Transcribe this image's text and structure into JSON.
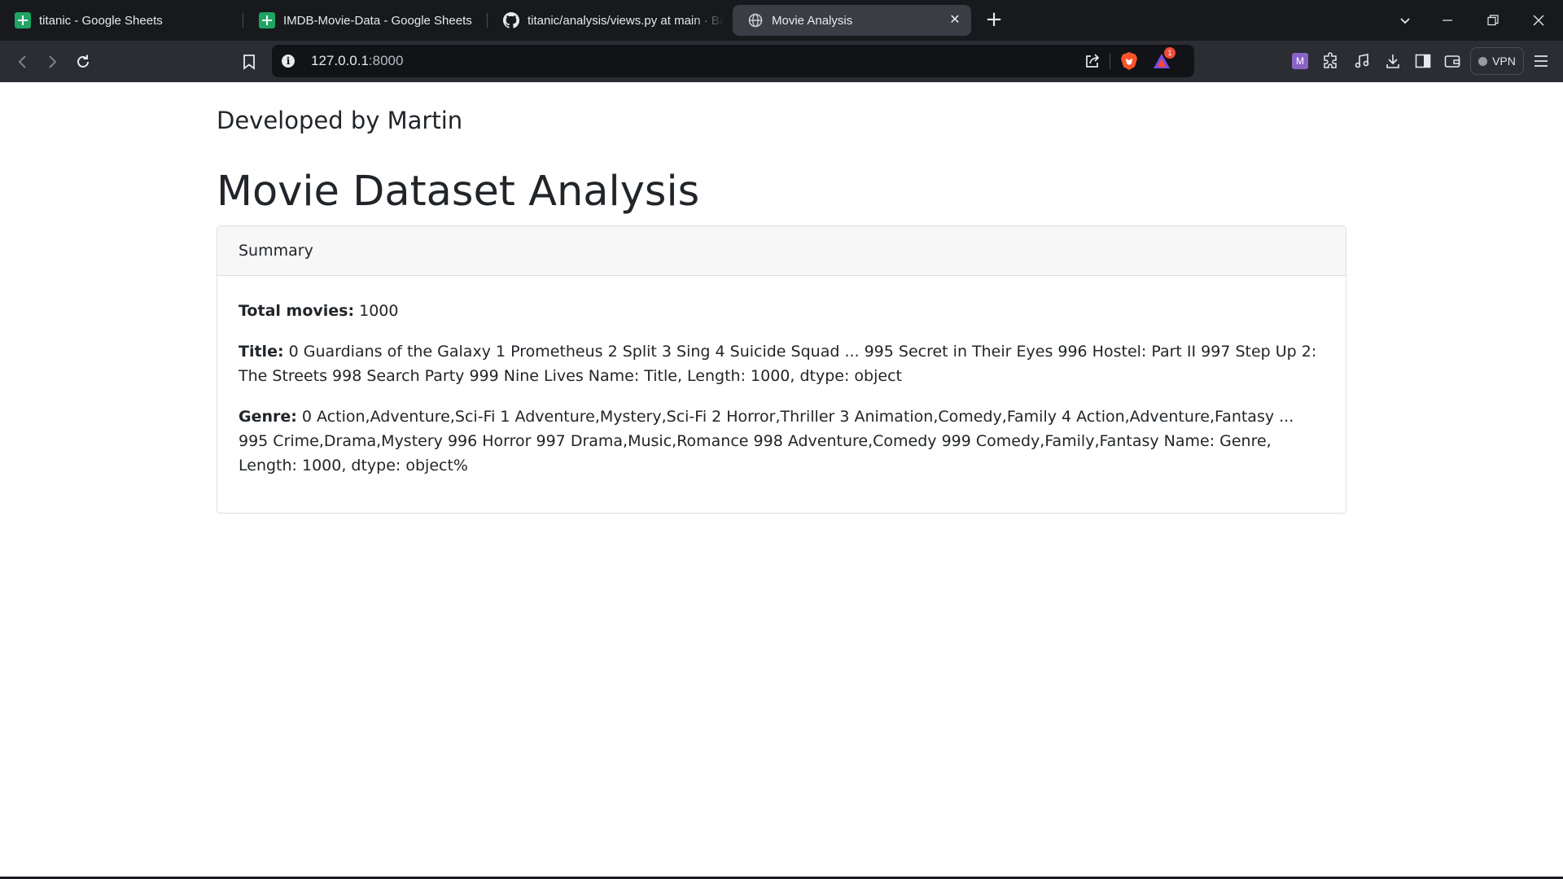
{
  "tabs": [
    {
      "title": "titanic - Google Sheets",
      "icon": "google-sheets-icon"
    },
    {
      "title": "IMDB-Movie-Data - Google Sheets",
      "icon": "google-sheets-icon"
    },
    {
      "title": "titanic/analysis/views.py at main · Ba",
      "icon": "github-icon"
    },
    {
      "title": "Movie Analysis",
      "icon": "globe-icon",
      "active": true
    }
  ],
  "address_bar": {
    "host": "127.0.0.1",
    "port": ":8000"
  },
  "vpn_label": "VPN",
  "notification_count": "1",
  "profile_letter": "M",
  "page": {
    "developer_line": "Developed by Martin",
    "title": "Movie Dataset Analysis",
    "card": {
      "header": "Summary",
      "total_label": "Total movies:",
      "total_value": "1000",
      "title_label": "Title:",
      "title_value": "0 Guardians of the Galaxy 1 Prometheus 2 Split 3 Sing 4 Suicide Squad ... 995 Secret in Their Eyes 996 Hostel: Part II 997 Step Up 2: The Streets 998 Search Party 999 Nine Lives Name: Title, Length: 1000, dtype: object",
      "genre_label": "Genre:",
      "genre_value": "0 Action,Adventure,Sci-Fi 1 Adventure,Mystery,Sci-Fi 2 Horror,Thriller 3 Animation,Comedy,Family 4 Action,Adventure,Fantasy ... 995 Crime,Drama,Mystery 996 Horror 997 Drama,Music,Romance 998 Adventure,Comedy 999 Comedy,Family,Fantasy Name: Genre, Length: 1000, dtype: object%"
    }
  },
  "colors": {
    "tabstrip": "#17191d",
    "toolbar": "#2b2d33",
    "urlbar": "#121317",
    "text": "#212529",
    "card_header_bg": "#f7f7f7",
    "card_border": "#dcdfe3",
    "brave_orange": "#fb542b"
  }
}
